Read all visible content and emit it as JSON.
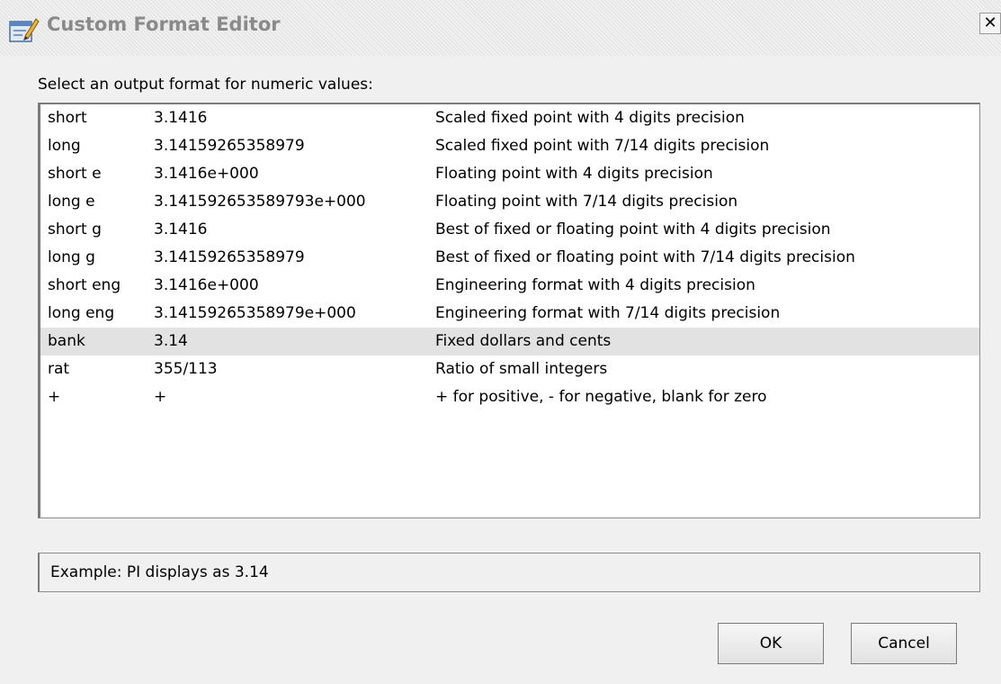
{
  "window": {
    "title": "Custom Format Editor",
    "close_label": "✕"
  },
  "prompt": "Select an output format for numeric values:",
  "formats": [
    {
      "name": "short",
      "example": "3.1416",
      "description": "Scaled fixed point with 4 digits precision"
    },
    {
      "name": "long",
      "example": "3.14159265358979",
      "description": "Scaled fixed point with 7/14 digits precision"
    },
    {
      "name": "short e",
      "example": "3.1416e+000",
      "description": "Floating point with 4 digits precision"
    },
    {
      "name": "long e",
      "example": "3.141592653589793e+000",
      "description": "Floating point with 7/14 digits precision"
    },
    {
      "name": "short g",
      "example": "3.1416",
      "description": "Best of fixed or floating point with 4 digits precision"
    },
    {
      "name": "long g",
      "example": "3.14159265358979",
      "description": "Best of fixed or floating point with 7/14 digits precision"
    },
    {
      "name": "short eng",
      "example": "3.1416e+000",
      "description": "Engineering format with 4 digits precision"
    },
    {
      "name": "long eng",
      "example": "3.14159265358979e+000",
      "description": "Engineering format with 7/14 digits precision"
    },
    {
      "name": "bank",
      "example": "3.14",
      "description": "Fixed dollars and cents",
      "selected": true
    },
    {
      "name": "rat",
      "example": "355/113",
      "description": "Ratio of small integers"
    },
    {
      "name": "+",
      "example": "+",
      "description": "+ for positive, - for negative, blank for zero"
    }
  ],
  "example_line": "Example:  PI displays as    3.14",
  "buttons": {
    "ok": "OK",
    "cancel": "Cancel"
  },
  "colors": {
    "selected_row": "#e2e2e2",
    "window_bg": "#f0f0f0",
    "title_text": "#8a8a8a"
  },
  "icons": {
    "title_icon": "edit-window-icon",
    "close_icon": "close-icon"
  }
}
